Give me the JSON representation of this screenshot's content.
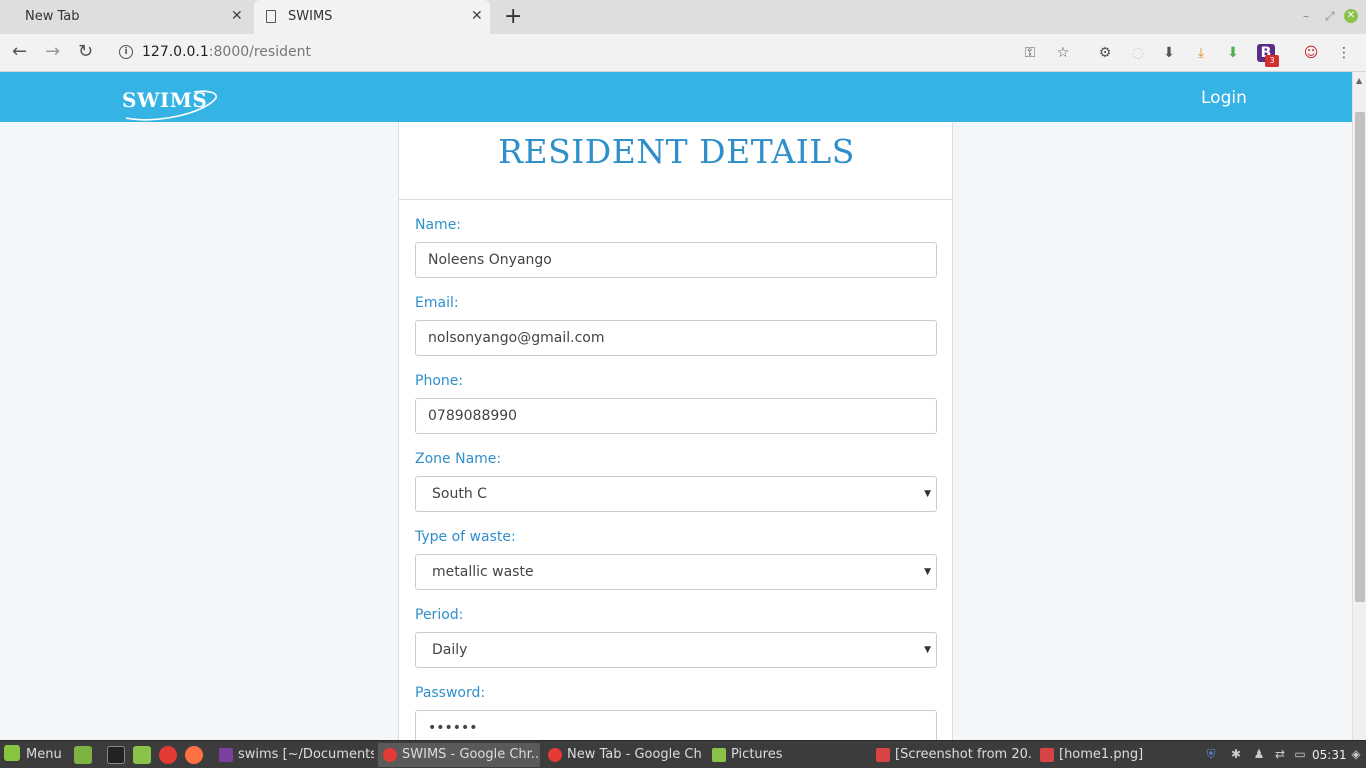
{
  "browser": {
    "tabs": [
      {
        "title": "New Tab"
      },
      {
        "title": "SWIMS"
      }
    ],
    "url_host": "127.0.0.1",
    "url_path": ":8000/resident"
  },
  "site": {
    "logo_text": "SWIMS",
    "login_label": "Login"
  },
  "form": {
    "title": "RESIDENT DETAILS",
    "fields": [
      {
        "label": "Name:",
        "value": "Noleens Onyango"
      },
      {
        "label": "Email:",
        "value": "nolsonyango@gmail.com"
      },
      {
        "label": "Phone:",
        "value": "0789088990"
      },
      {
        "label": "Zone Name:",
        "value": "South C"
      },
      {
        "label": "Type of waste:",
        "value": "metallic waste"
      },
      {
        "label": "Period:",
        "value": "Daily"
      },
      {
        "label": "Password:",
        "value": "••••••"
      }
    ]
  },
  "toolbar_icons": [
    "key-icon",
    "star-icon",
    "extension-icon",
    "shield-extension-icon",
    "download-icon",
    "download-alt-icon",
    "download-green-icon",
    "b-extension-icon",
    "profile-icon",
    "menu-dots-icon"
  ],
  "extension_badge": "3",
  "taskbar": {
    "menu_label": "Menu",
    "windows": [
      {
        "label": "swims [~/Documents..."
      },
      {
        "label": "SWIMS - Google Chr..."
      },
      {
        "label": "New Tab - Google Ch..."
      },
      {
        "label": "Pictures"
      },
      {
        "label": "[Screenshot from 20..."
      },
      {
        "label": "[home1.png]"
      }
    ],
    "clock": "05:31"
  },
  "colors": {
    "header": "#35b3e4",
    "accent": "#2f8fcb",
    "background": "#f4f7f9"
  }
}
